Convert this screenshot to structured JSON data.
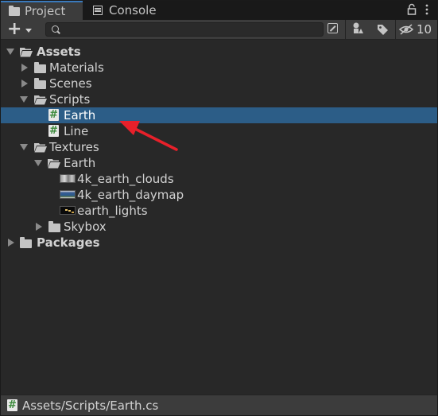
{
  "tabs": [
    {
      "label": "Project",
      "active": true,
      "icon": "folder-icon"
    },
    {
      "label": "Console",
      "active": false,
      "icon": "console-icon"
    }
  ],
  "toolbar": {
    "create_icon": "plus-icon",
    "search_value": "",
    "hidden_count": "10"
  },
  "tree": [
    {
      "label": "Assets",
      "icon": "folder-open-icon",
      "expanded": true,
      "bold": true
    },
    {
      "label": "Materials",
      "icon": "folder-icon",
      "expanded": false
    },
    {
      "label": "Scenes",
      "icon": "folder-icon",
      "expanded": false
    },
    {
      "label": "Scripts",
      "icon": "folder-open-icon",
      "expanded": true
    },
    {
      "label": "Earth",
      "icon": "csharp-script-icon",
      "selected": true
    },
    {
      "label": "Line",
      "icon": "csharp-script-icon"
    },
    {
      "label": "Textures",
      "icon": "folder-open-icon",
      "expanded": true
    },
    {
      "label": "Earth",
      "icon": "folder-open-icon",
      "expanded": true
    },
    {
      "label": "4k_earth_clouds",
      "icon": "texture-thumbnail-icon"
    },
    {
      "label": "4k_earth_daymap",
      "icon": "texture-thumbnail-icon"
    },
    {
      "label": "earth_lights",
      "icon": "texture-thumbnail-icon"
    },
    {
      "label": "Skybox",
      "icon": "folder-icon",
      "expanded": false
    },
    {
      "label": "Packages",
      "icon": "folder-icon",
      "expanded": false,
      "bold": true
    }
  ],
  "status": {
    "path": "Assets/Scripts/Earth.cs"
  },
  "colors": {
    "selection": "#2c5d87",
    "annotation_arrow": "#e8202a",
    "panel_bg": "#282828"
  }
}
